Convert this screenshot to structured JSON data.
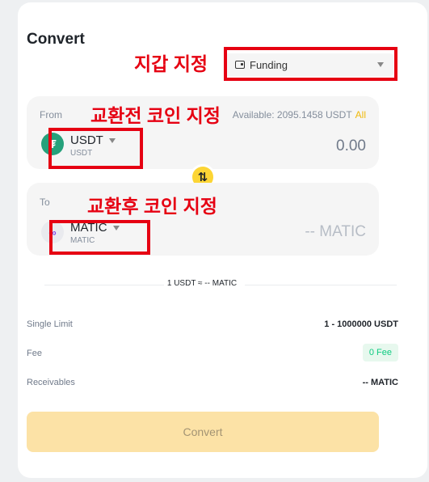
{
  "header": {
    "title": "Convert"
  },
  "wallet": {
    "label": "Funding",
    "icon": "wallet-icon"
  },
  "annotations": {
    "wallet": "지갑 지정",
    "from_coin": "교환전 코인 지정",
    "to_coin": "교환후 코인 지정",
    "color": "#e60012"
  },
  "from": {
    "label": "From",
    "available_text": "Available: 2095.1458 USDT",
    "all_label": "All",
    "coin": {
      "symbol": "USDT",
      "sub": "USDT",
      "icon": "tether-icon",
      "glyph": "₮",
      "color": "#26a17b"
    },
    "amount": "0.00"
  },
  "to": {
    "label": "To",
    "coin": {
      "symbol": "MATIC",
      "sub": "MATIC",
      "icon": "polygon-icon",
      "glyph": "∞",
      "color": "#8247e5"
    },
    "amount": "-- MATIC"
  },
  "swap": {
    "icon": "swap-arrows-icon",
    "glyph": "⇅"
  },
  "rate": "1 USDT ≈ -- MATIC",
  "details": {
    "single_limit_label": "Single Limit",
    "single_limit_value": "1 - 1000000 USDT",
    "fee_label": "Fee",
    "fee_value": "0 Fee",
    "receivables_label": "Receivables",
    "receivables_value": "-- MATIC"
  },
  "actions": {
    "convert_label": "Convert"
  },
  "colors": {
    "accent": "#fcd535",
    "button_disabled": "#fce2a6",
    "fee_green": "#0ecb81"
  }
}
